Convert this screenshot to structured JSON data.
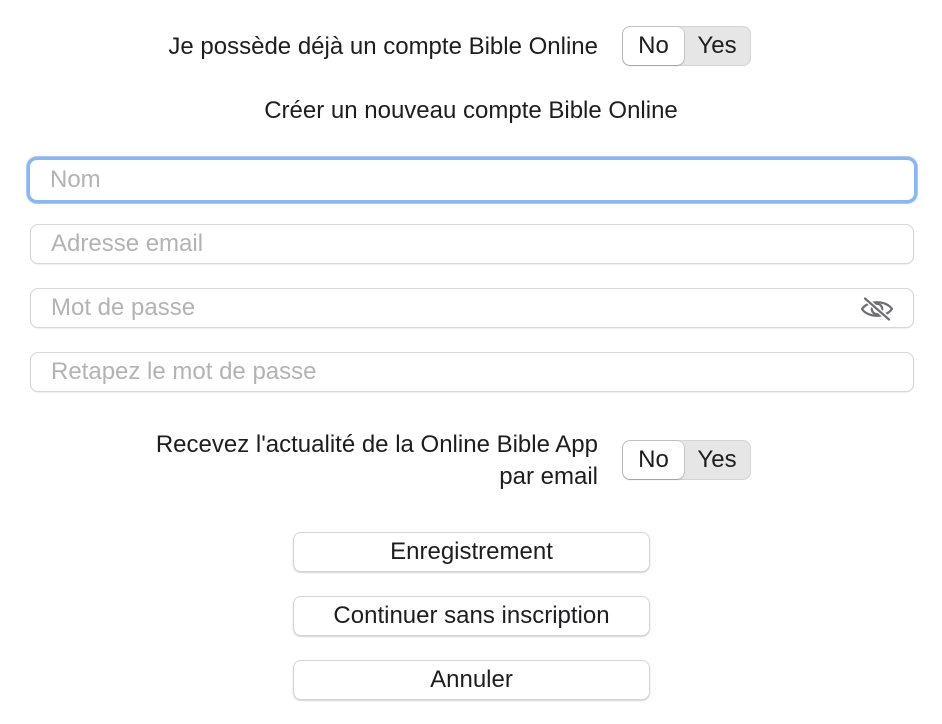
{
  "existing_account": {
    "label": "Je possède déjà un compte Bible Online",
    "options": [
      "No",
      "Yes"
    ],
    "selected": "No"
  },
  "heading": "Créer un nouveau compte Bible Online",
  "fields": {
    "name": {
      "placeholder": "Nom",
      "value": ""
    },
    "email": {
      "placeholder": "Adresse email",
      "value": ""
    },
    "password": {
      "placeholder": "Mot de passe",
      "value": "",
      "icon": "eye-slash-icon"
    },
    "password_confirm": {
      "placeholder": "Retapez le mot de passe",
      "value": ""
    }
  },
  "newsletter": {
    "label_line1": "Recevez l'actualité de la Online Bible App",
    "label_line2": "par email",
    "options": [
      "No",
      "Yes"
    ],
    "selected": "No"
  },
  "buttons": {
    "register": "Enregistrement",
    "continue": "Continuer sans inscription",
    "cancel": "Annuler"
  },
  "colors": {
    "focus_ring": "#8cb6f0",
    "placeholder": "#b3b3b3",
    "text": "#1d1d1f"
  }
}
